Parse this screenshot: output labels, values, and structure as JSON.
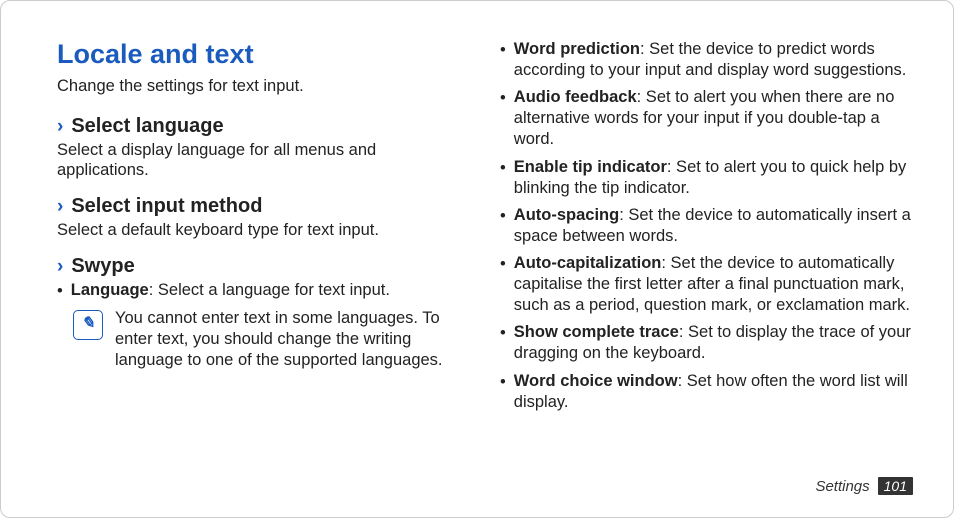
{
  "title": "Locale and text",
  "intro": "Change the settings for text input.",
  "sections": [
    {
      "heading": "Select language",
      "desc": "Select a display language for all menus and applications."
    },
    {
      "heading": "Select input method",
      "desc": "Select a default keyboard type for text input."
    },
    {
      "heading": "Swype",
      "desc": ""
    }
  ],
  "swype_language": {
    "term": "Language",
    "desc": ": Select a language for text input."
  },
  "note": "You cannot enter text in some languages. To enter text, you should change the writing language to one of the supported languages.",
  "bullets": [
    {
      "term": "Word prediction",
      "desc": ": Set the device to predict words according to your input and display word suggestions."
    },
    {
      "term": "Audio feedback",
      "desc": ": Set to alert you when there are no alternative words for your input if you double-tap a word."
    },
    {
      "term": "Enable tip indicator",
      "desc": ": Set to alert you to quick help by blinking the tip indicator."
    },
    {
      "term": "Auto-spacing",
      "desc": ": Set the device to automatically insert a space between words."
    },
    {
      "term": "Auto-capitalization",
      "desc": ": Set the device to automatically capitalise the first letter after a final punctuation mark, such as a period, question mark, or exclamation mark."
    },
    {
      "term": "Show complete trace",
      "desc": ": Set to display the trace of your dragging on the keyboard."
    },
    {
      "term": "Word choice window",
      "desc": ": Set how often the word list will display."
    }
  ],
  "footer": {
    "label": "Settings",
    "page": "101"
  },
  "note_icon_glyph": "✎"
}
